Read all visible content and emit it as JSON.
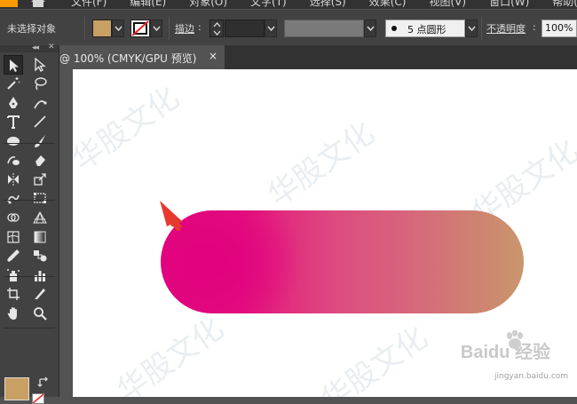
{
  "menubar": {
    "items": [
      "文件(F)",
      "编辑(E)",
      "对象(O)",
      "文字(T)",
      "选择(S)",
      "效果(C)",
      "视图(V)",
      "窗口(W)",
      "帮助(H)"
    ]
  },
  "controlbar": {
    "selection_status": "未选择对象",
    "fill_color": "#C8A064",
    "stroke_label": "描边",
    "brush_label": "5 点圆形",
    "opacity_label": "不透明度",
    "opacity_value": "100%"
  },
  "document_tab": {
    "title": "@ 100% (CMYK/GPU 预览)",
    "close": "×"
  },
  "canvas": {
    "shape": "rounded-rectangle",
    "gradient_colors": [
      "#E2007F",
      "#DE4B80",
      "#C9966C"
    ],
    "arrow_color": "#E8392E",
    "watermark": "华股文化",
    "baidu_logo": "Baidu 经验",
    "baidu_url": "jingyan.baidu.com"
  },
  "tools": [
    "selection-tool",
    "direct-selection-tool",
    "magic-wand-tool",
    "lasso-tool",
    "pen-tool",
    "curvature-tool",
    "type-tool",
    "line-segment-tool",
    "ellipse-tool",
    "paintbrush-tool",
    "shaper-tool",
    "eraser-tool",
    "reflect-tool",
    "scale-tool",
    "puppet-warp-tool",
    "free-transform-tool",
    "shape-builder-tool",
    "perspective-grid-tool",
    "mesh-tool",
    "gradient-tool",
    "eyedropper-tool",
    "blend-tool",
    "symbol-sprayer-tool",
    "column-graph-tool",
    "artboard-tool",
    "slice-tool",
    "hand-tool",
    "zoom-tool"
  ]
}
